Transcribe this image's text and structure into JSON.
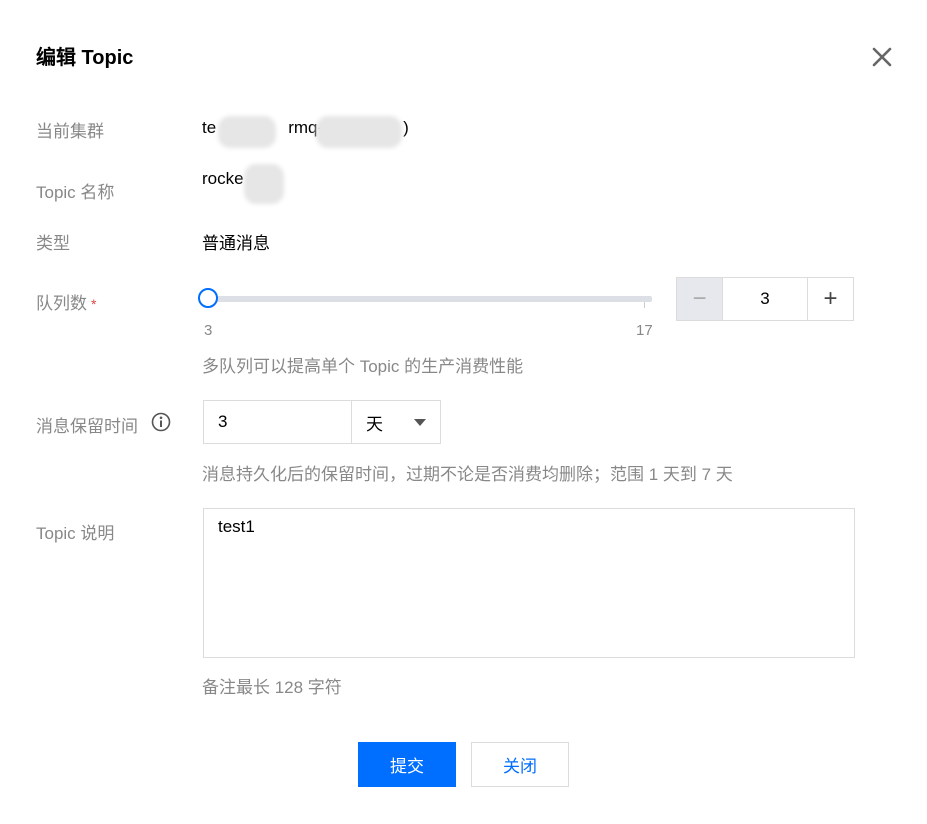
{
  "dialog": {
    "title": "编辑 Topic",
    "close_icon": "close-icon"
  },
  "fields": {
    "cluster": {
      "label": "当前集群",
      "value_prefix": "te",
      "value_mid": "rmq-",
      "value_suffix": ")"
    },
    "topic_name": {
      "label": "Topic 名称",
      "value": "rocke"
    },
    "type": {
      "label": "类型",
      "value": "普通消息"
    },
    "queues": {
      "label": "队列数",
      "required_mark": "*",
      "min": "3",
      "max": "17",
      "value": "3",
      "slider_fraction": 0,
      "minus": "−",
      "plus": "+",
      "hint": "多队列可以提高单个 Topic 的生产消费性能"
    },
    "retention": {
      "label": "消息保留时间",
      "info_icon": "info-icon",
      "value": "3",
      "unit": "天",
      "hint": "消息持久化后的保留时间，过期不论是否消费均删除；范围 1 天到 7 天"
    },
    "description": {
      "label": "Topic 说明",
      "value": "test1",
      "hint": "备注最长 128 字符"
    }
  },
  "buttons": {
    "submit": "提交",
    "close": "关闭"
  },
  "colors": {
    "accent": "#006eff",
    "label": "#888888",
    "required": "#e54545"
  }
}
